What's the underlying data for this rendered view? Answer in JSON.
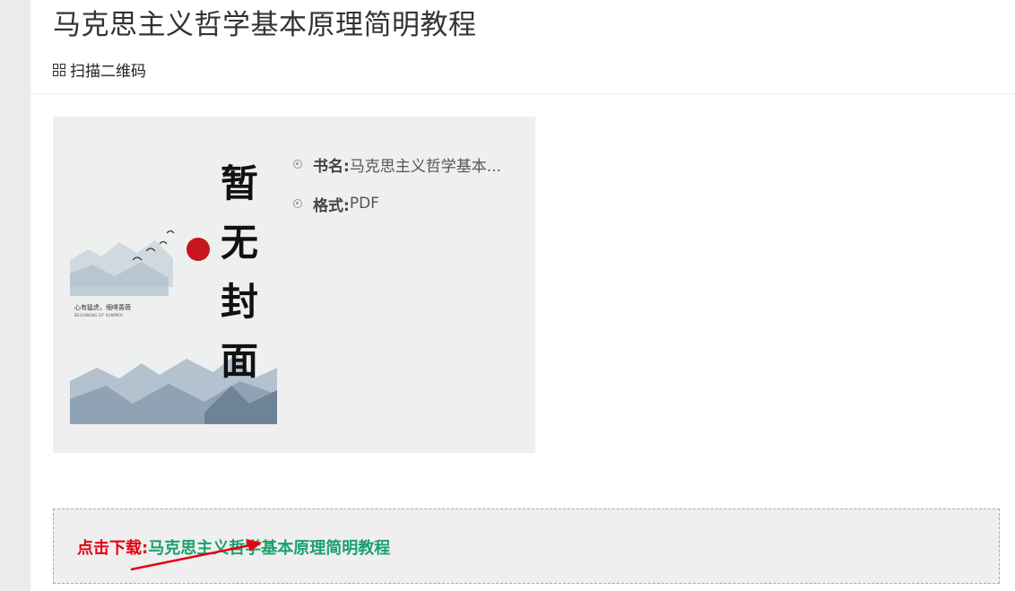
{
  "page": {
    "title": "马克思主义哲学基本原理简明教程",
    "qr_label": "扫描二维码"
  },
  "cover": {
    "placeholder_text": [
      "暂",
      "无",
      "封",
      "面"
    ],
    "motto": "心有猛虎，细嗅蔷薇",
    "motto_en": "BEGINNING OF SUMMER"
  },
  "book_info": {
    "name_label": "书名:",
    "name_value": "马克思主义哲学基本...",
    "format_label": "格式:",
    "format_value": "PDF"
  },
  "download": {
    "prefix": "点击下载:",
    "link_text": "马克思主义哲学基本原理简明教程"
  },
  "colors": {
    "download_prefix": "#e60012",
    "download_link": "#1aa06d",
    "annotation_arrow": "#e60012"
  },
  "icons": {
    "qr": "qr-code-icon",
    "bullet": "circle-bullet-icon"
  }
}
